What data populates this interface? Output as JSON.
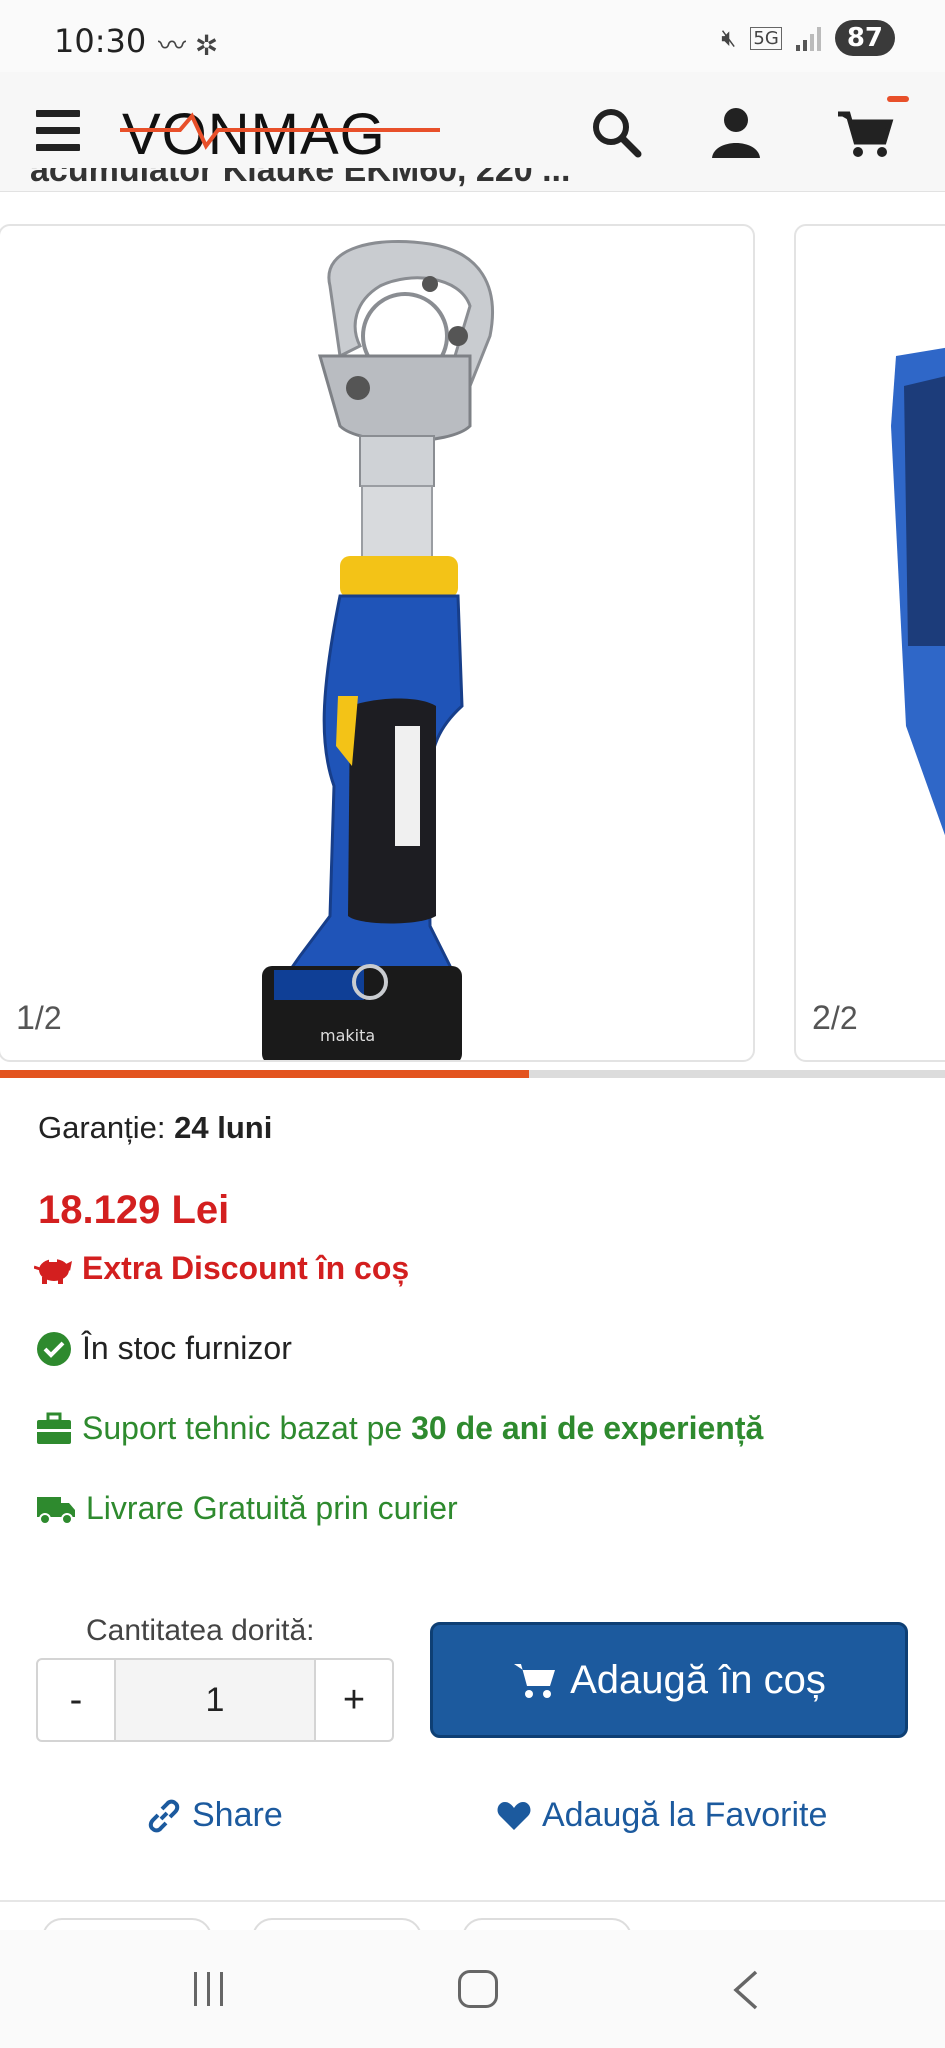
{
  "status_bar": {
    "time": "10:30",
    "left_icons": "〰 ✲",
    "network": "5G",
    "battery": "87"
  },
  "header": {
    "logo": "VONMAG",
    "icons": [
      "menu-icon",
      "search-icon",
      "user-icon",
      "cart-icon"
    ],
    "accent_color": "#e8502a"
  },
  "product": {
    "title_cut": "acumulator Klauke EKM60, 220 ..."
  },
  "gallery": {
    "current": "1",
    "current_total": "/2",
    "next": "2",
    "next_total": "/2",
    "progress_fraction": 0.5
  },
  "info": {
    "warranty_label": "Garanție:",
    "warranty_value": "24 luni",
    "price": "18.129 Lei",
    "discount": "Extra Discount în coș",
    "stock": "În stoc furnizor",
    "support_prefix": "Suport tehnic bazat pe",
    "support_bold": "30 de ani de experiență",
    "delivery": "Livrare Gratuită prin curier"
  },
  "cart": {
    "qty_label": "Cantitatea dorită:",
    "minus": "-",
    "qty_value": "1",
    "plus": "+",
    "add_label": "Adaugă în coș",
    "button_color": "#1c5a9e"
  },
  "actions": {
    "share": "Share",
    "favorite": "Adaugă la Favorite"
  },
  "colors": {
    "price_red": "#d31f1f",
    "green": "#2e8a2e",
    "blue": "#1c5a9e"
  }
}
